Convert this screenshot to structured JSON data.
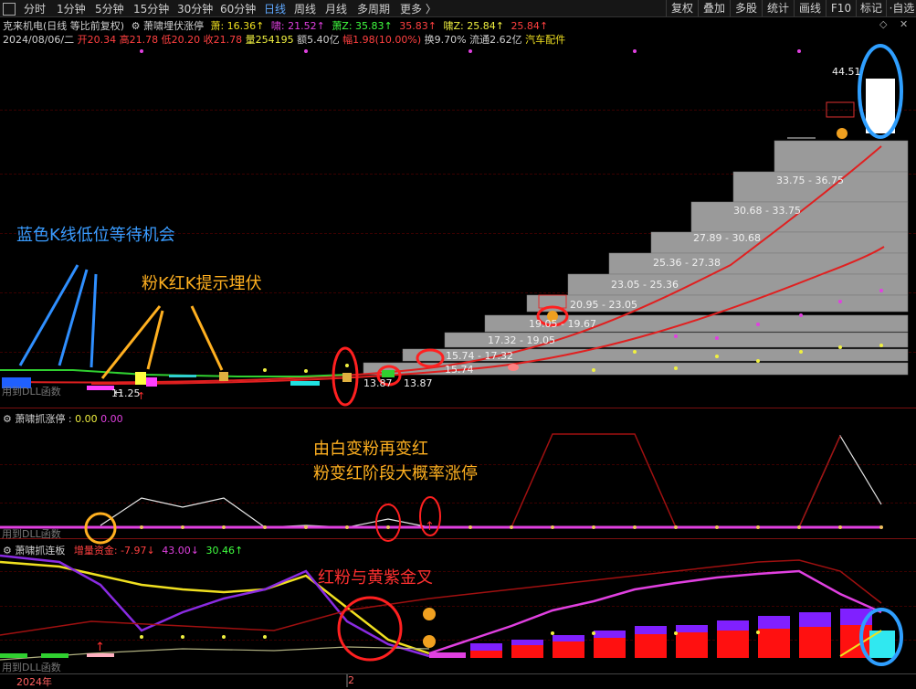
{
  "toolbar": {
    "tabs": [
      "分时",
      "1分钟",
      "5分钟",
      "15分钟",
      "30分钟",
      "60分钟",
      "日线",
      "周线",
      "月线",
      "多周期",
      "更多 〉"
    ],
    "active_tab": "日线",
    "right_buttons": [
      "复权",
      "叠加",
      "多股",
      "统计",
      "画线",
      "F10",
      "标记",
      "·自选"
    ]
  },
  "header": {
    "stock_title": "克来机电(日线 等比前复权)",
    "indicator_name": "萧啸埋伏涨停",
    "v1_label": "萧: 16.36↑",
    "v2_label": "啸: 21.52↑",
    "v3_label": "萧Z: 35.83↑",
    "v4_label": "35.83↑",
    "v5_label": "啸Z: 25.84↑",
    "v6_label": "25.84↑"
  },
  "quote": {
    "date": "2024/08/06/二",
    "open": "开20.34",
    "high": "高21.78",
    "low": "低20.20",
    "close": "收21.78",
    "volume": "量254195",
    "amount": "额5.40亿",
    "change": "幅1.98(10.00%)",
    "turnover": "换9.70%",
    "float_cap": "流通2.62亿",
    "sector": "汽车配件"
  },
  "main_chart": {
    "price_labels": {
      "top": "44.51",
      "low_mark": "11.25",
      "p1": "13.87",
      "p2": "13.87"
    },
    "range_labels": [
      "33.75 - 36.75",
      "30.68 - 33.75",
      "27.89 - 30.68",
      "25.36 - 27.38",
      "23.05 - 25.36",
      "20.95 - 23.05",
      "19.05 - 19.67",
      "17.32 - 19.05",
      "15.74 - 17.32",
      "15.74"
    ],
    "watermark": "用到DLL函数"
  },
  "annotations": {
    "blue": "蓝色K线低位等待机会",
    "yellow": "粉K红K提示埋伏",
    "orange1": "由白变粉再变红",
    "orange2": "粉变红阶段大概率涨停",
    "red": "红粉与黄紫金叉"
  },
  "panel2": {
    "title": "萧啸抓涨停",
    "v1": "0.00",
    "v2": "0.00",
    "watermark": "用到DLL函数"
  },
  "panel3": {
    "title": "萧啸抓连板",
    "v1": "增量资金: -7.97↓",
    "v2": "43.00↓",
    "v3": "30.46↑",
    "watermark": "用到DLL函数"
  },
  "axis": {
    "year": "2024年",
    "month": "2"
  },
  "colors": {
    "accent_blue": "#2f8fff",
    "annotation_orange": "#ffb020",
    "annotation_red": "#ff3030",
    "magenta": "#e040e0",
    "purple": "#8a2be2",
    "yellow": "#f0e020"
  }
}
